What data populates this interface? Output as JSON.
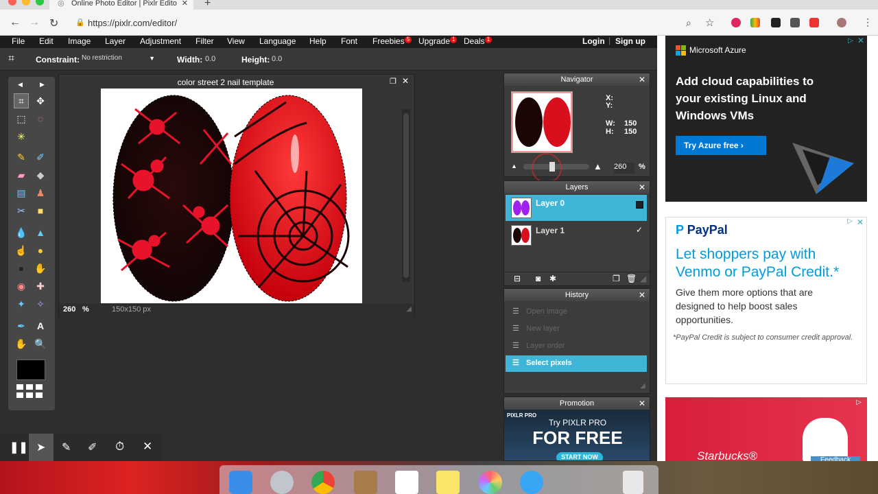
{
  "browser": {
    "tab_title": "Online Photo Editor | Pixlr Edito",
    "tab_close": "✕",
    "new_tab": "+",
    "url": "https://pixlr.com/editor/"
  },
  "menu": {
    "items": [
      "File",
      "Edit",
      "Image",
      "Layer",
      "Adjustment",
      "Filter",
      "View",
      "Language",
      "Help",
      "Font",
      "Freebies",
      "Upgrade",
      "Deals"
    ],
    "freebies_badge": "5",
    "upgrade_badge": "1",
    "deals_badge": "1",
    "login": "Login",
    "signup": "Sign up"
  },
  "options": {
    "constraint_label": "Constraint:",
    "constraint_value": "No restriction",
    "width_label": "Width:",
    "width_value": "0.0",
    "height_label": "Height:",
    "height_value": "0.0"
  },
  "document": {
    "title": "color street 2 nail template",
    "zoom": "260",
    "zoom_unit": "%",
    "size": "150x150 px"
  },
  "navigator": {
    "title": "Navigator",
    "x_label": "X:",
    "y_label": "Y:",
    "w_label": "W:",
    "w_value": "150",
    "h_label": "H:",
    "h_value": "150",
    "zoom": "260",
    "zoom_unit": "%"
  },
  "layers": {
    "title": "Layers",
    "items": [
      {
        "name": "Layer 0"
      },
      {
        "name": "Layer 1"
      }
    ]
  },
  "history": {
    "title": "History",
    "items": [
      "Open image",
      "New layer",
      "Layer order",
      "Select pixels"
    ]
  },
  "promotion": {
    "title": "Promotion",
    "brand": "PIXLR PRO",
    "line1": "Try PIXLR PRO",
    "line2": "FOR FREE",
    "cta": "START NOW"
  },
  "ads": {
    "azure_brand": "Microsoft Azure",
    "azure_headline": "Add cloud capabilities to your existing Linux and Windows VMs",
    "azure_cta": "Try Azure free",
    "paypal_brand": "PayPal",
    "paypal_headline": "Let shoppers pay with Venmo or PayPal Credit.*",
    "paypal_body": "Give them more options that are designed to help boost sales opportunities.",
    "paypal_note": "*PayPal Credit is subject to consumer credit approval.",
    "starbucks": "Starbucks®",
    "feedback": "Feedback"
  },
  "colors": {
    "accent": "#3fb6d8",
    "azure_blue": "#0078d4",
    "paypal_blue": "#009cde"
  }
}
